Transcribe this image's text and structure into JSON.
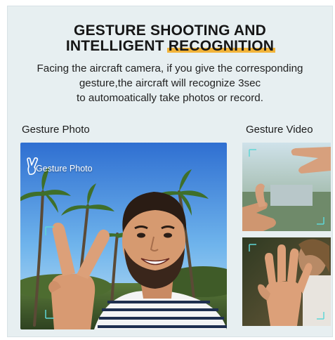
{
  "headline": {
    "line1": "GESTURE SHOOTING AND",
    "line2_prefix": "INTELLIGENT ",
    "line2_highlight": "RECOGNITION"
  },
  "description": {
    "line1": "Facing the aircraft camera, if you give the corresponding",
    "line2": "gesture,the aircraft will recognize 3sec",
    "line3": "to automoatically take photos or record."
  },
  "gesture_photo": {
    "label": "Gesture Photo",
    "overlay_label": "Gesture Photo",
    "overlay_icon": "victory-hand-icon"
  },
  "gesture_video": {
    "label": "Gesture Video"
  },
  "colors": {
    "highlight": "#f2b43a",
    "card_background": "#e7eff1",
    "focus_brackets": "#5fd6d6"
  }
}
